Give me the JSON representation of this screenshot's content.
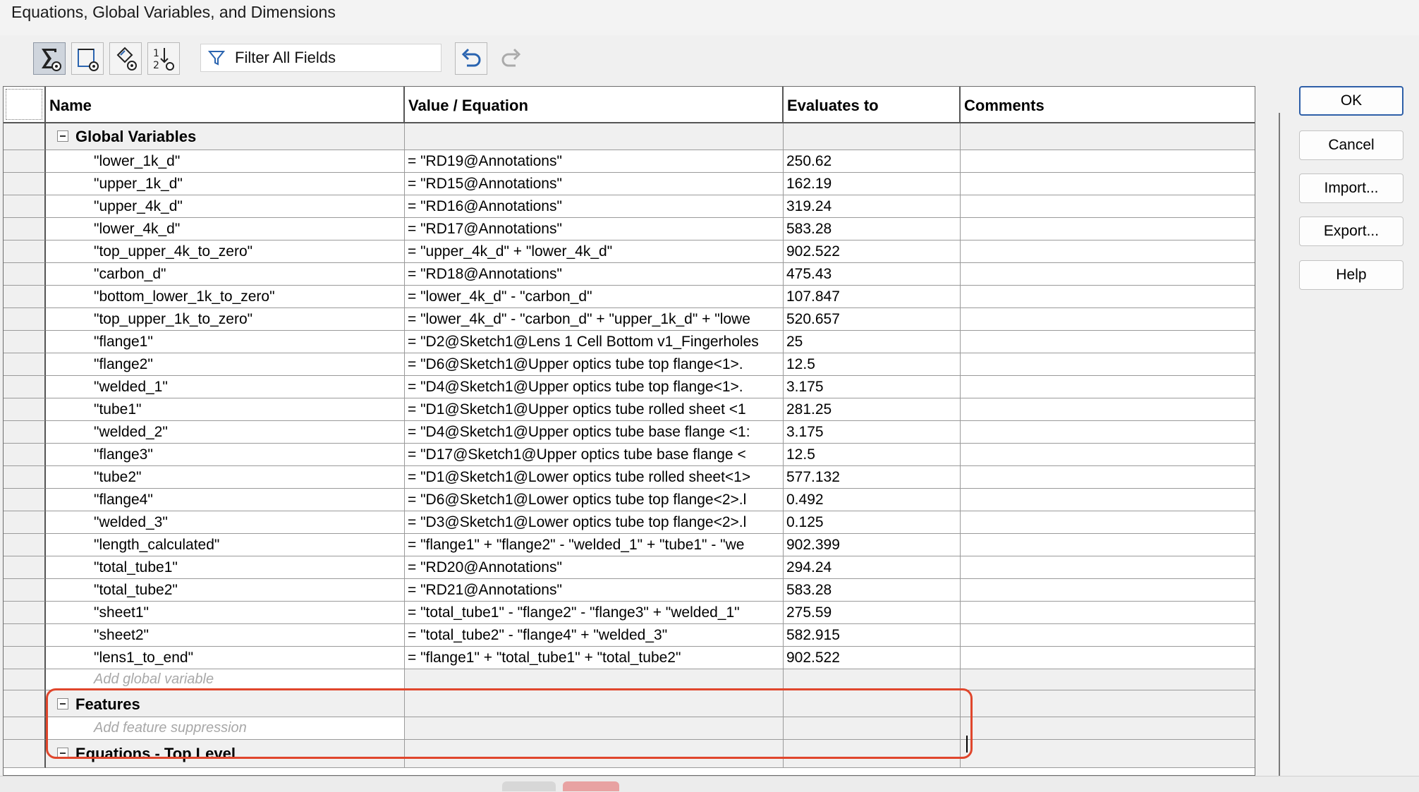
{
  "window": {
    "title": "Equations, Global Variables, and Dimensions"
  },
  "toolbar": {
    "buttons": [
      {
        "name": "equation-view-icon",
        "active": true
      },
      {
        "name": "sketch-equation-view-icon",
        "active": false
      },
      {
        "name": "dimension-view-icon",
        "active": false
      },
      {
        "name": "ordered-view-icon",
        "active": false
      }
    ],
    "filter_label": "Filter All Fields",
    "undo_icon": "undo-icon",
    "redo_icon": "redo-icon"
  },
  "grid": {
    "headers": {
      "name": "Name",
      "value": "Value / Equation",
      "evaluates": "Evaluates to",
      "comments": "Comments"
    },
    "global_group": {
      "label": "Global Variables",
      "add_placeholder": "Add global variable"
    },
    "rows": [
      {
        "name": "\"lower_1k_d\"",
        "value": "= \"RD19@Annotations\"",
        "eval": "250.62",
        "comment": ""
      },
      {
        "name": "\"upper_1k_d\"",
        "value": "= \"RD15@Annotations\"",
        "eval": "162.19",
        "comment": ""
      },
      {
        "name": "\"upper_4k_d\"",
        "value": "= \"RD16@Annotations\"",
        "eval": "319.24",
        "comment": ""
      },
      {
        "name": "\"lower_4k_d\"",
        "value": "= \"RD17@Annotations\"",
        "eval": "583.28",
        "comment": ""
      },
      {
        "name": "\"top_upper_4k_to_zero\"",
        "value": "= \"upper_4k_d\" + \"lower_4k_d\"",
        "eval": "902.522",
        "comment": ""
      },
      {
        "name": "\"carbon_d\"",
        "value": "= \"RD18@Annotations\"",
        "eval": "475.43",
        "comment": ""
      },
      {
        "name": "\"bottom_lower_1k_to_zero\"",
        "value": "= \"lower_4k_d\" - \"carbon_d\"",
        "eval": "107.847",
        "comment": ""
      },
      {
        "name": "\"top_upper_1k_to_zero\"",
        "value": "= \"lower_4k_d\" - \"carbon_d\" + \"upper_1k_d\" + \"lowe",
        "eval": "520.657",
        "comment": ""
      },
      {
        "name": "\"flange1\"",
        "value": "= \"D2@Sketch1@Lens 1 Cell Bottom v1_Fingerholes",
        "eval": "25",
        "comment": ""
      },
      {
        "name": "\"flange2\"",
        "value": "= \"D6@Sketch1@Upper optics tube top flange<1>.",
        "eval": "12.5",
        "comment": ""
      },
      {
        "name": "\"welded_1\"",
        "value": "= \"D4@Sketch1@Upper optics tube top flange<1>.",
        "eval": "3.175",
        "comment": ""
      },
      {
        "name": "\"tube1\"",
        "value": "= \"D1@Sketch1@Upper optics tube rolled sheet <1",
        "eval": "281.25",
        "comment": ""
      },
      {
        "name": "\"welded_2\"",
        "value": "= \"D4@Sketch1@Upper optics tube base flange <1:",
        "eval": "3.175",
        "comment": ""
      },
      {
        "name": "\"flange3\"",
        "value": "= \"D17@Sketch1@Upper optics tube base flange <",
        "eval": "12.5",
        "comment": ""
      },
      {
        "name": "\"tube2\"",
        "value": "= \"D1@Sketch1@Lower optics tube rolled sheet<1>",
        "eval": "577.132",
        "comment": ""
      },
      {
        "name": "\"flange4\"",
        "value": "= \"D6@Sketch1@Lower optics tube top flange<2>.l",
        "eval": "0.492",
        "comment": ""
      },
      {
        "name": "\"welded_3\"",
        "value": "= \"D3@Sketch1@Lower optics tube top flange<2>.l",
        "eval": "0.125",
        "comment": ""
      },
      {
        "name": "\"length_calculated\"",
        "value": "= \"flange1\" + \"flange2\" - \"welded_1\" + \"tube1\" - \"we",
        "eval": "902.399",
        "comment": ""
      },
      {
        "name": "\"total_tube1\"",
        "value": "= \"RD20@Annotations\"",
        "eval": "294.24",
        "comment": ""
      },
      {
        "name": "\"total_tube2\"",
        "value": "= \"RD21@Annotations\"",
        "eval": "583.28",
        "comment": ""
      },
      {
        "name": "\"sheet1\"",
        "value": "= \"total_tube1\" - \"flange2\" - \"flange3\" + \"welded_1\"",
        "eval": "275.59",
        "comment": ""
      },
      {
        "name": "\"sheet2\"",
        "value": "= \"total_tube2\" - \"flange4\" + \"welded_3\"",
        "eval": "582.915",
        "comment": ""
      },
      {
        "name": "\"lens1_to_end\"",
        "value": "= \"flange1\" + \"total_tube1\" + \"total_tube2\"",
        "eval": "902.522",
        "comment": ""
      }
    ],
    "features_group": {
      "label": "Features",
      "add_placeholder": "Add feature suppression"
    },
    "equations_group": {
      "label": "Equations - Top Level"
    }
  },
  "side_buttons": {
    "ok": "OK",
    "cancel": "Cancel",
    "import": "Import...",
    "export": "Export...",
    "help": "Help"
  },
  "colors": {
    "highlight": "#e0462c",
    "default_button_border": "#2e5fa8"
  }
}
